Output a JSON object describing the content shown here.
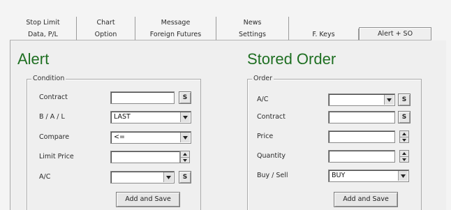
{
  "tabs": {
    "row1": [
      "Stop Limit",
      "Chart",
      "Message",
      "News"
    ],
    "row2": [
      "Data, P/L",
      "Option",
      "Foreign Futures",
      "Settings",
      "F. Keys",
      "Alert + SO"
    ],
    "active": "Alert + SO"
  },
  "alert": {
    "title": "Alert",
    "group_label": "Condition",
    "labels": {
      "contract": "Contract",
      "biasl": "B / A / L",
      "compare": "Compare",
      "limit_price": "Limit Price",
      "ac": "A/C"
    },
    "values": {
      "contract": "",
      "biasl": "LAST",
      "compare": "<=",
      "limit_price": "",
      "ac": ""
    },
    "search_btn": "S",
    "submit": "Add and Save"
  },
  "stored_order": {
    "title": "Stored Order",
    "group_label": "Order",
    "labels": {
      "ac": "A/C",
      "contract": "Contract",
      "price": "Price",
      "quantity": "Quantity",
      "buy_sell": "Buy / Sell"
    },
    "values": {
      "ac": "",
      "contract": "",
      "price": "",
      "quantity": "",
      "buy_sell": "BUY"
    },
    "search_btn": "S",
    "submit": "Add and Save"
  }
}
